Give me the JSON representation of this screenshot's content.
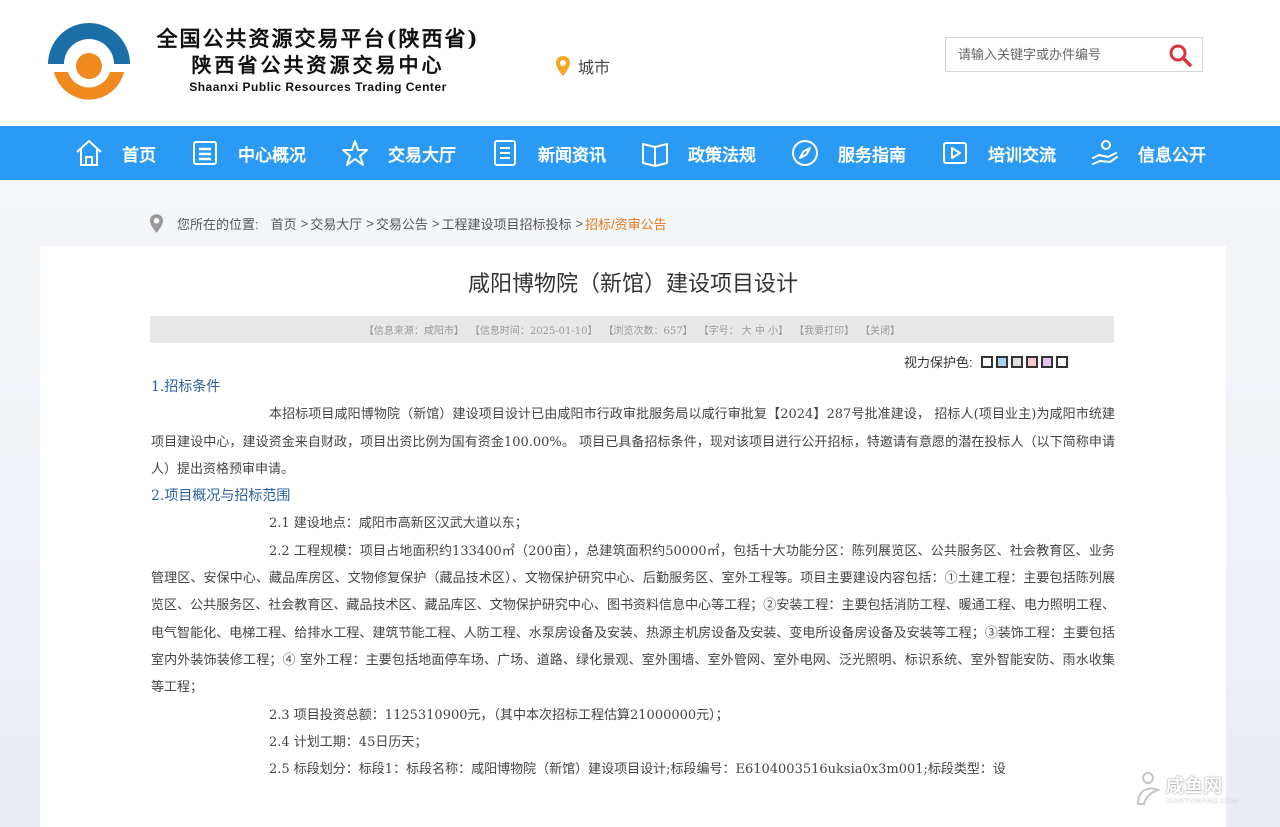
{
  "header": {
    "logo_line1": "全国公共资源交易平台(陕西省)",
    "logo_line2": "陕西省公共资源交易中心",
    "logo_line3": "Shaanxi Public Resources Trading Center",
    "city_label": "城市",
    "search_placeholder": "请输入关键字或办件编号"
  },
  "nav": {
    "items": [
      {
        "label": "首页",
        "icon": "home-icon"
      },
      {
        "label": "中心概况",
        "icon": "document-icon"
      },
      {
        "label": "交易大厅",
        "icon": "star-icon"
      },
      {
        "label": "新闻资讯",
        "icon": "list-icon"
      },
      {
        "label": "政策法规",
        "icon": "book-icon"
      },
      {
        "label": "服务指南",
        "icon": "compass-icon"
      },
      {
        "label": "培训交流",
        "icon": "play-icon"
      },
      {
        "label": "信息公开",
        "icon": "hand-icon"
      }
    ]
  },
  "breadcrumb": {
    "prefix": "您所在的位置:",
    "items": [
      "首页",
      "交易大厅",
      "交易公告",
      "工程建设项目招标投标"
    ],
    "current": "招标/资审公告",
    "sep": ">"
  },
  "article": {
    "title": "咸阳博物院（新馆）建设项目设计",
    "info": {
      "source": "【信息来源：咸阳市】",
      "time": "【信息时间：2025-01-10】",
      "views": "【浏览次数：657】",
      "font": "【字号： 大 中 小】",
      "print": "【我要打印】",
      "close": "【关闭】"
    },
    "eye_label": "视力保护色:",
    "eye_colors": [
      "#ffffff",
      "#a9d4f0",
      "#e0e0e0",
      "#f7c6cd",
      "#e6c4f0",
      "#ffffff"
    ],
    "sections": {
      "s1_head": "1.招标条件",
      "s1_p": "本招标项目咸阳博物院（新馆）建设项目设计已由咸阳市行政审批服务局以咸行审批复【2024】287号批准建设， 招标人(项目业主)为咸阳市统建项目建设中心，建设资金来自财政，项目出资比例为国有资金100.00%。 项目已具备招标条件，现对该项目进行公开招标，特邀请有意愿的潜在投标人（以下简称申请人）提出资格预审申请。",
      "s2_head": "2.项目概况与招标范围",
      "s2_1": "2.1 建设地点：咸阳市高新区汉武大道以东；",
      "s2_2": "2.2 工程规模：项目占地面积约133400㎡（200亩），总建筑面积约50000㎡，包括十大功能分区：陈列展览区、公共服务区、社会教育区、业务管理区、安保中心、藏品库房区、文物修复保护（藏品技术区）、文物保护研究中心、后勤服务区、室外工程等。项目主要建设内容包括：①土建工程：主要包括陈列展览区、公共服务区、社会教育区、藏品技术区、藏品库区、文物保护研究中心、图书资料信息中心等工程；②安装工程：主要包括消防工程、暖通工程、电力照明工程、电气智能化、电梯工程、给排水工程、建筑节能工程、人防工程、水泵房设备及安装、热源主机房设备及安装、变电所设备房设备及安装等工程；③装饰工程：主要包括室内外装饰装修工程；④ 室外工程：主要包括地面停车场、广场、道路、绿化景观、室外围墙、室外管网、室外电网、泛光照明、标识系统、室外智能安防、雨水收集等工程；",
      "s2_3": "2.3 项目投资总额：1125310900元，（其中本次招标工程估算21000000元）；",
      "s2_4": "2.4 计划工期：45日历天；",
      "s2_5": "2.5 标段划分：标段1：标段名称：咸阳博物院（新馆）建设项目设计;标段编号：E6104003516uksia0x3m001;标段类型：设"
    }
  },
  "watermark": {
    "cn": "咸鱼网",
    "en": "XIANYUWANG.COM"
  }
}
